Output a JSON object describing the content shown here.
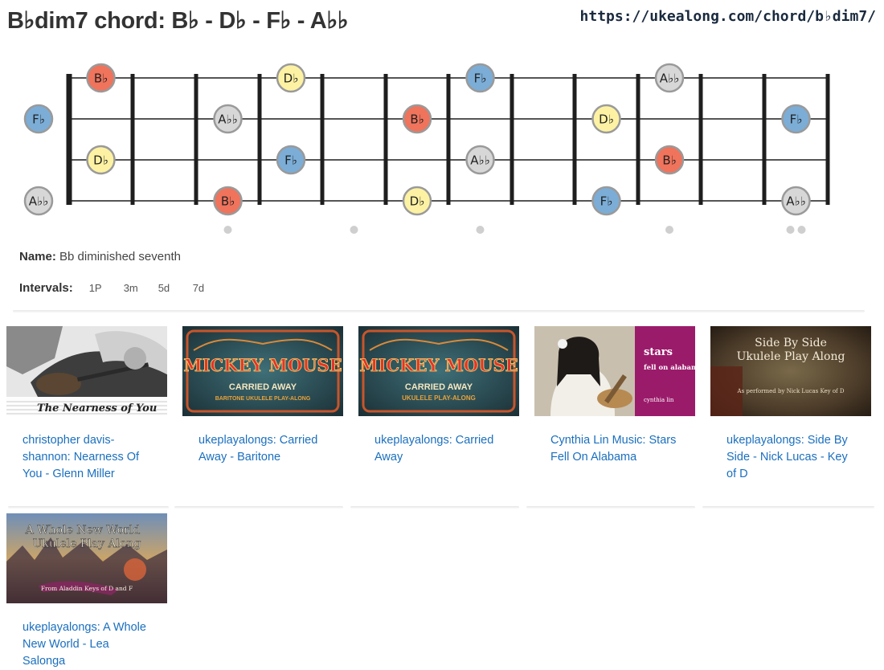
{
  "header": {
    "title": "B♭dim7 chord: B♭ - D♭ - F♭ - A♭♭",
    "url": "https://ukealong.com/chord/b♭dim7/"
  },
  "fretboard": {
    "notes": [
      {
        "string": 1,
        "fret": 0,
        "label": "F♭",
        "color": "#7badd6"
      },
      {
        "string": 1,
        "fret": 3,
        "label": "A♭♭",
        "color": "#d7d7d7"
      },
      {
        "string": 1,
        "fret": 6,
        "label": "B♭",
        "color": "#f0735c"
      },
      {
        "string": 1,
        "fret": 9,
        "label": "D♭",
        "color": "#fdf2a3"
      },
      {
        "string": 1,
        "fret": 12,
        "label": "F♭",
        "color": "#7badd6"
      },
      {
        "string": 0,
        "fret": 1,
        "label": "B♭",
        "color": "#f0735c"
      },
      {
        "string": 0,
        "fret": 4,
        "label": "D♭",
        "color": "#fdf2a3"
      },
      {
        "string": 0,
        "fret": 7,
        "label": "F♭",
        "color": "#7badd6"
      },
      {
        "string": 0,
        "fret": 10,
        "label": "A♭♭",
        "color": "#d7d7d7"
      },
      {
        "string": 2,
        "fret": 1,
        "label": "D♭",
        "color": "#fdf2a3"
      },
      {
        "string": 2,
        "fret": 4,
        "label": "F♭",
        "color": "#7badd6"
      },
      {
        "string": 2,
        "fret": 7,
        "label": "A♭♭",
        "color": "#d7d7d7"
      },
      {
        "string": 2,
        "fret": 10,
        "label": "B♭",
        "color": "#f0735c"
      },
      {
        "string": 3,
        "fret": 0,
        "label": "A♭♭",
        "color": "#d7d7d7"
      },
      {
        "string": 3,
        "fret": 3,
        "label": "B♭",
        "color": "#f0735c"
      },
      {
        "string": 3,
        "fret": 6,
        "label": "D♭",
        "color": "#fdf2a3"
      },
      {
        "string": 3,
        "fret": 9,
        "label": "F♭",
        "color": "#7badd6"
      },
      {
        "string": 3,
        "fret": 12,
        "label": "A♭♭",
        "color": "#d7d7d7"
      }
    ],
    "inlays": [
      3,
      5,
      7,
      10,
      12
    ]
  },
  "info": {
    "name_label": "Name:",
    "name_value": "Bb diminished seventh",
    "intervals_label": "Intervals:",
    "intervals": [
      "1P",
      "3m",
      "5d",
      "7d"
    ]
  },
  "videos": [
    {
      "title": "christopher davis-shannon: Nearness Of You - Glenn Miller",
      "thumb_text": "The Nearness of You"
    },
    {
      "title": "ukeplayalongs: Carried Away - Baritone",
      "thumb_text": "MICKEY MOUSE",
      "thumb_sub1": "CARRIED AWAY",
      "thumb_sub2": "BARITONE UKULELE PLAY-ALONG"
    },
    {
      "title": "ukeplayalongs: Carried Away",
      "thumb_text": "MICKEY MOUSE",
      "thumb_sub1": "CARRIED AWAY",
      "thumb_sub2": "UKULELE PLAY-ALONG"
    },
    {
      "title": "Cynthia Lin Music: Stars Fell On Alabama",
      "thumb_text": "stars",
      "thumb_sub1": "fell on alabama",
      "thumb_sub2": "cynthia lin"
    },
    {
      "title": "ukeplayalongs: Side By Side - Nick Lucas - Key of D",
      "thumb_text": "Side By Side",
      "thumb_sub1": "Ukulele Play Along",
      "thumb_sub2": "As performed by Nick Lucas Key of D"
    },
    {
      "title": "ukeplayalongs: A Whole New World - Lea Salonga",
      "thumb_text": "A Whole New World",
      "thumb_sub1": "Ukulele Play Along",
      "thumb_sub2": "From Aladdin Keys of D and F"
    }
  ]
}
